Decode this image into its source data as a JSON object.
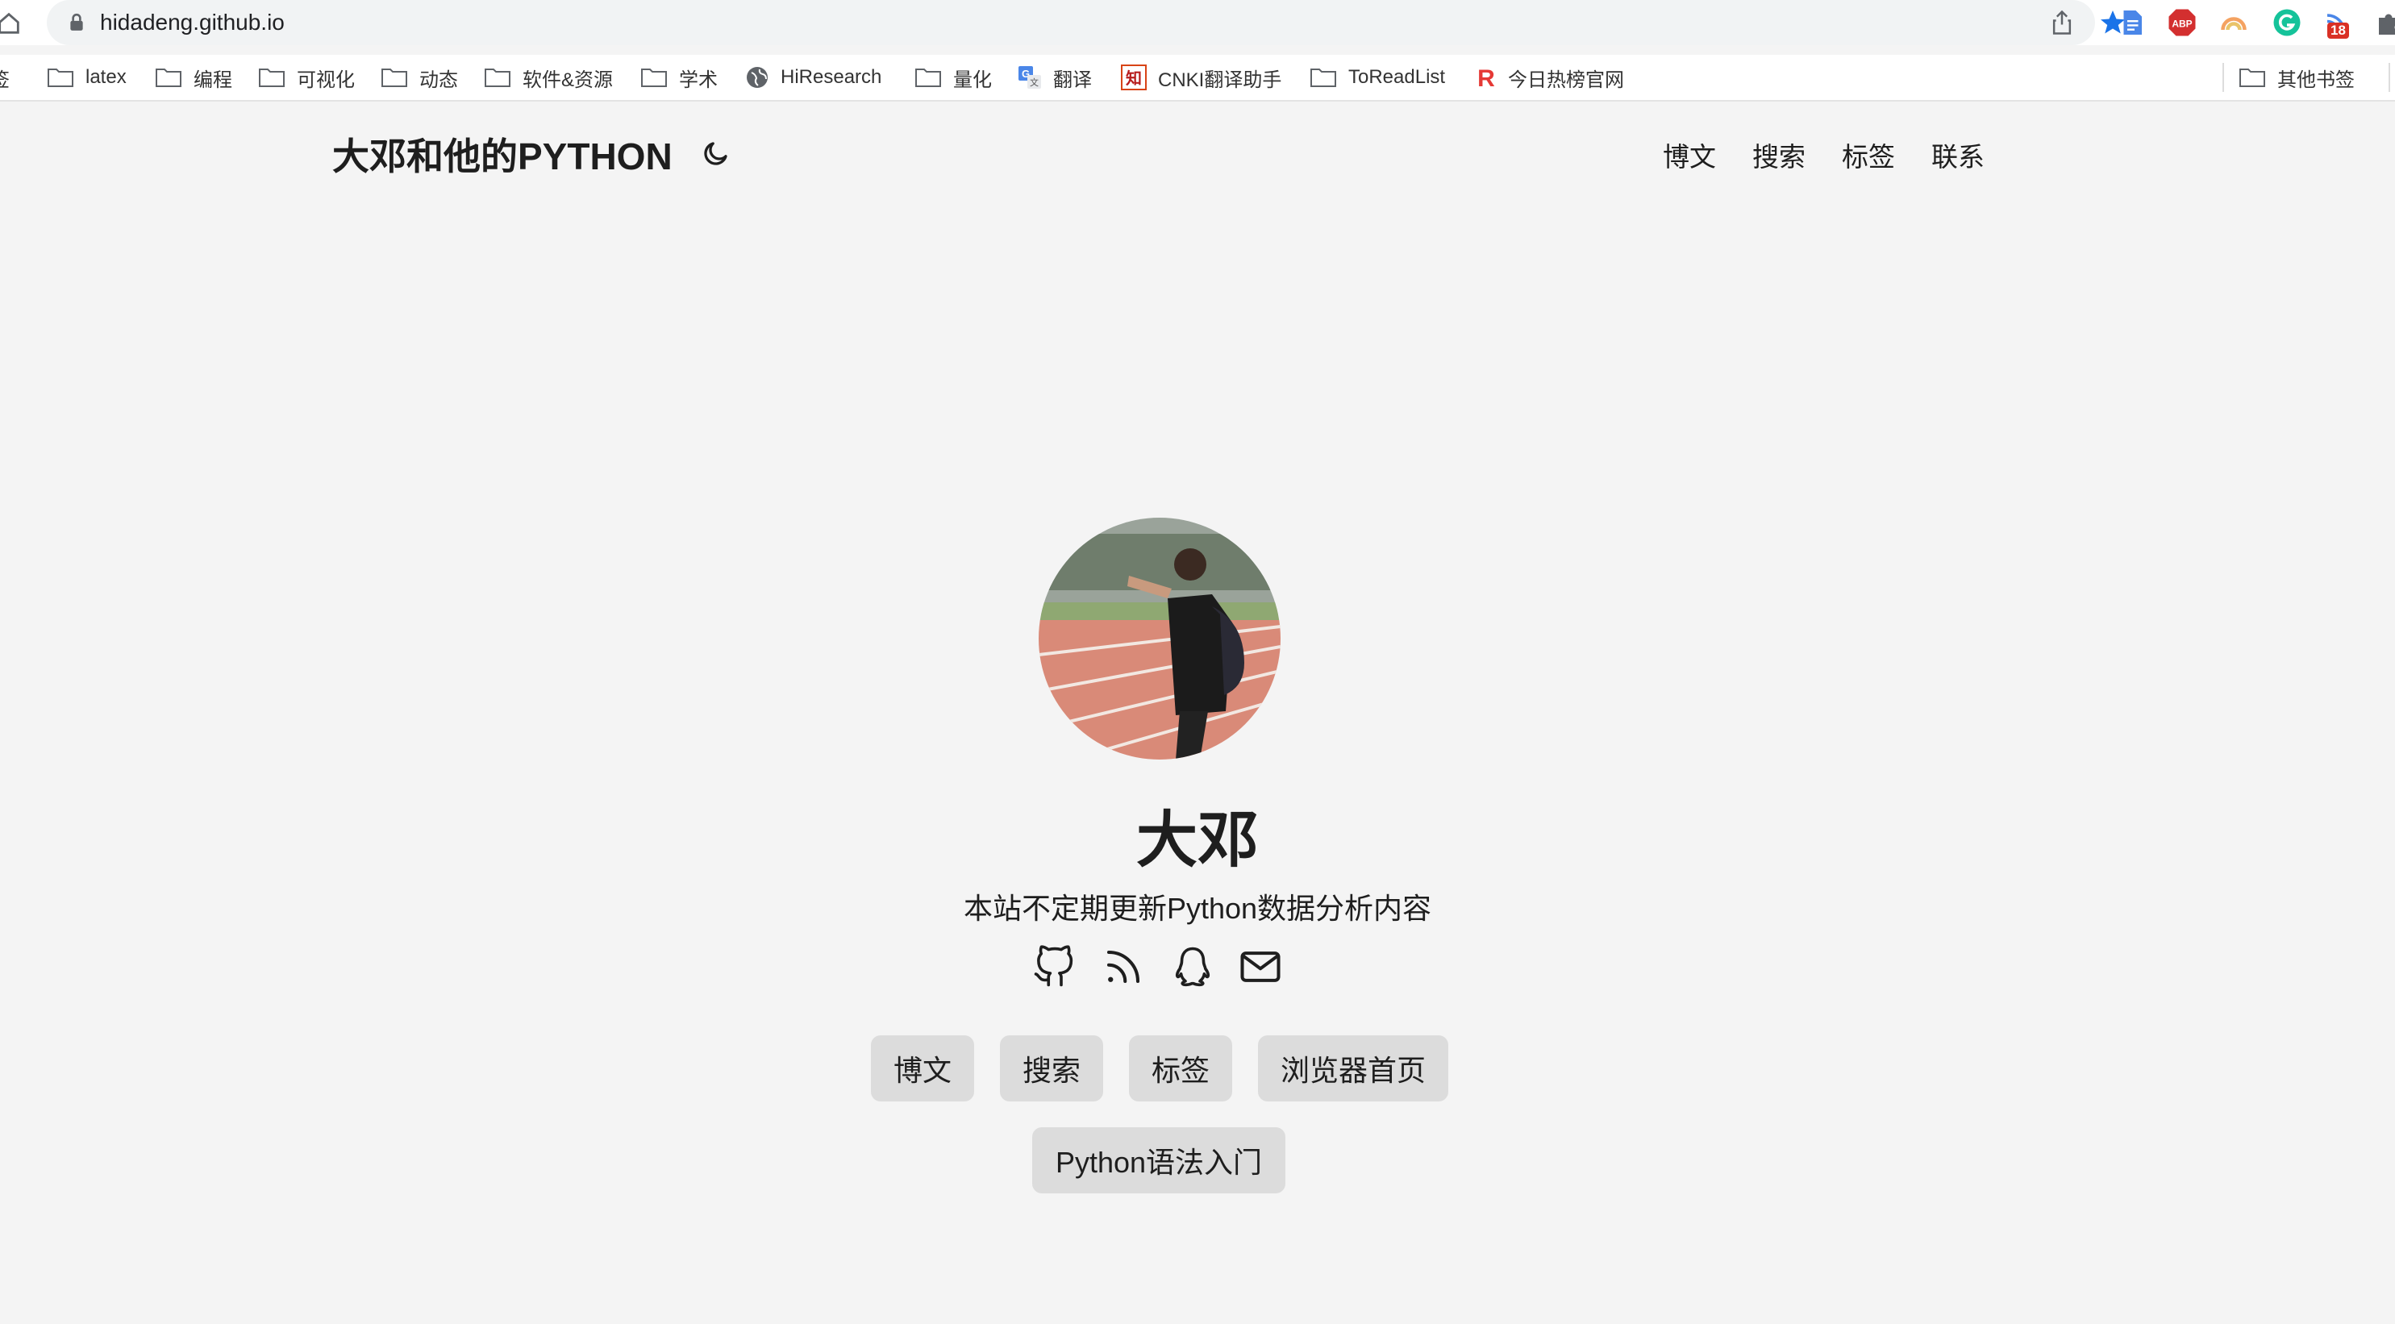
{
  "browser": {
    "url": "hidadeng.github.io",
    "extension_badge": "18",
    "bookmarks": [
      {
        "label": "签",
        "icon": "folder-icon"
      },
      {
        "label": "latex",
        "icon": "folder-icon"
      },
      {
        "label": "编程",
        "icon": "folder-icon"
      },
      {
        "label": "可视化",
        "icon": "folder-icon"
      },
      {
        "label": "动态",
        "icon": "folder-icon"
      },
      {
        "label": "软件&资源",
        "icon": "folder-icon"
      },
      {
        "label": "学术",
        "icon": "folder-icon"
      },
      {
        "label": "HiResearch",
        "icon": "globe-icon"
      },
      {
        "label": "量化",
        "icon": "folder-icon"
      },
      {
        "label": "翻译",
        "icon": "translate-icon"
      },
      {
        "label": "CNKI翻译助手",
        "icon": "cnki-icon"
      },
      {
        "label": "ToReadList",
        "icon": "folder-icon"
      },
      {
        "label": "今日热榜官网",
        "icon": "r-logo-icon"
      },
      {
        "label": "其他书签",
        "icon": "folder-icon"
      }
    ],
    "colors": {
      "accent_star": "#1a73e8",
      "badge": "#d93025"
    }
  },
  "site": {
    "title": "大邓和他的PYTHON",
    "nav": [
      "博文",
      "搜索",
      "标签",
      "联系"
    ]
  },
  "profile": {
    "name": "大邓",
    "description": "本站不定期更新Python数据分析内容",
    "social_icons": [
      "github-icon",
      "rss-icon",
      "qq-icon",
      "mail-icon"
    ],
    "buttons": [
      "博文",
      "搜索",
      "标签",
      "浏览器首页",
      "Python语法入门"
    ]
  }
}
